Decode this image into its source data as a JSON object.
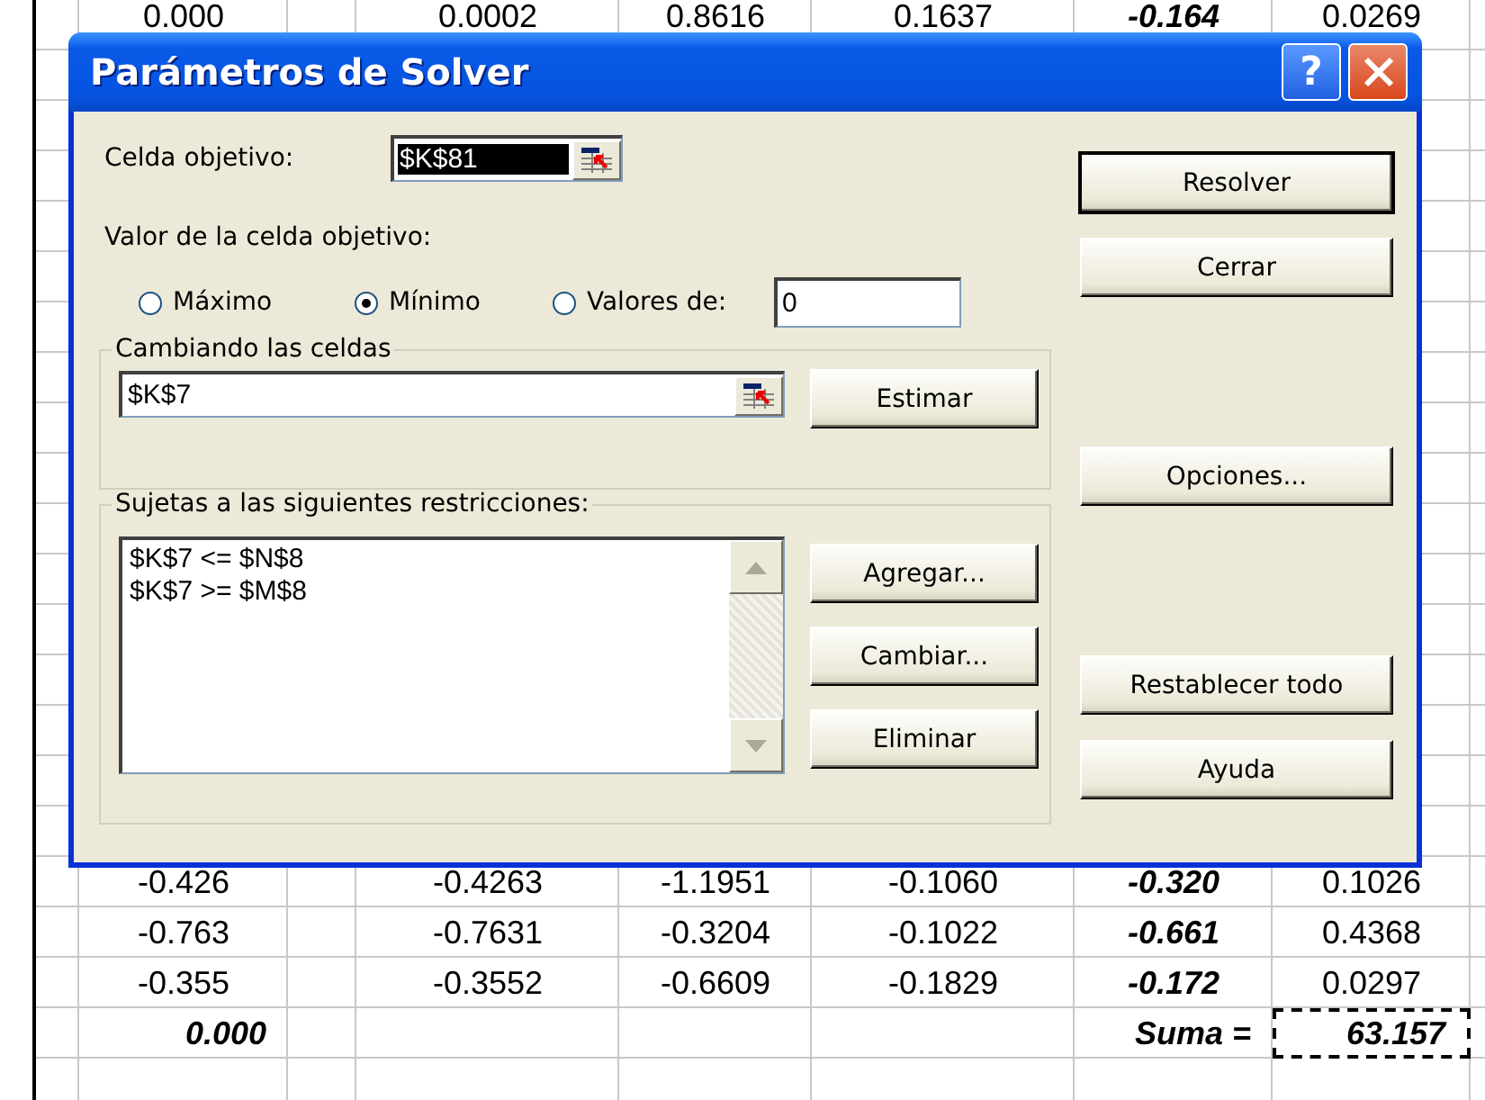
{
  "sheet": {
    "top_row": [
      "0.000",
      "0.0002",
      "0.8616",
      "0.1637",
      "-0.164",
      "0.0269"
    ],
    "rows": [
      [
        "-0.426",
        "-0.4263",
        "-1.1951",
        "-0.1060",
        "-0.320",
        "0.1026"
      ],
      [
        "-0.763",
        "-0.7631",
        "-0.3204",
        "-0.1022",
        "-0.661",
        "0.4368"
      ],
      [
        "-0.355",
        "-0.3552",
        "-0.6609",
        "-0.1829",
        "-0.172",
        "0.0297"
      ]
    ],
    "sum_row": {
      "total": "0.000",
      "label": "Suma =",
      "value": "63.157",
      "selected": true
    }
  },
  "dialog": {
    "title": "Parámetros de Solver",
    "help": "?",
    "target_cell": {
      "label": "Celda objetivo:",
      "value": "$K$81"
    },
    "value_label": "Valor de la celda objetivo:",
    "options": [
      {
        "label": "Máximo",
        "selected": false
      },
      {
        "label": "Mínimo",
        "selected": true
      },
      {
        "label": "Valores de:",
        "selected": false
      }
    ],
    "value_of": "0",
    "changing": {
      "legend": "Cambiando las celdas",
      "value": "$K$7",
      "button": "Estimar"
    },
    "constraints": {
      "legend": "Sujetas a las siguientes restricciones:",
      "items": [
        "$K$7 <= $N$8",
        "$K$7 >= $M$8"
      ],
      "buttons": [
        "Agregar...",
        "Cambiar...",
        "Eliminar"
      ]
    },
    "side_buttons": [
      [
        {
          "label": "Resolver",
          "default": true
        },
        {
          "label": "Cerrar",
          "default": false
        }
      ],
      [
        {
          "label": "Opciones...",
          "default": false
        }
      ],
      [
        {
          "label": "Restablecer todo",
          "default": false
        },
        {
          "label": "Ayuda",
          "default": false
        }
      ]
    ]
  }
}
